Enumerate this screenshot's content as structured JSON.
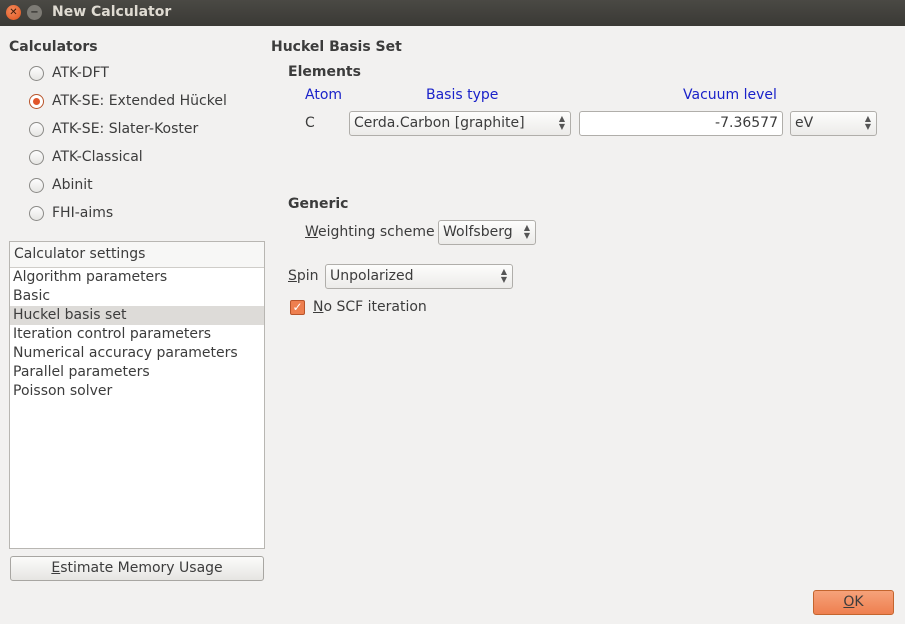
{
  "window": {
    "title": "New Calculator"
  },
  "calculators": {
    "heading": "Calculators",
    "options": [
      {
        "label": "ATK-DFT",
        "selected": false
      },
      {
        "label": "ATK-SE: Extended Hückel",
        "selected": true
      },
      {
        "label": "ATK-SE: Slater-Koster",
        "selected": false
      },
      {
        "label": "ATK-Classical",
        "selected": false
      },
      {
        "label": "Abinit",
        "selected": false
      },
      {
        "label": "FHI-aims",
        "selected": false
      }
    ]
  },
  "settings_list": {
    "header": "Calculator settings",
    "items": [
      "Algorithm parameters",
      "Basic",
      "Huckel basis set",
      "Iteration control parameters",
      "Numerical accuracy parameters",
      "Parallel parameters",
      "Poisson solver"
    ],
    "selected": "Huckel basis set"
  },
  "estimate_button": {
    "mnemonic": "E",
    "rest": "stimate Memory Usage"
  },
  "panel": {
    "title": "Huckel Basis Set",
    "elements_heading": "Elements",
    "columns": {
      "atom": "Atom",
      "basis_type": "Basis type",
      "vacuum_level": "Vacuum level"
    },
    "row": {
      "atom": "C",
      "basis_type": "Cerda.Carbon [graphite]",
      "vacuum_level": "-7.36577",
      "unit": "eV"
    },
    "generic_heading": "Generic",
    "weighting": {
      "mnemonic": "W",
      "rest": "eighting scheme",
      "value": "Wolfsberg"
    },
    "spin": {
      "mnemonic": "S",
      "rest": "pin",
      "value": "Unpolarized"
    },
    "no_scf": {
      "mnemonic": "N",
      "rest": "o SCF iteration",
      "checked": true
    }
  },
  "ok_button": {
    "mnemonic": "O",
    "rest": "K"
  },
  "colors": {
    "accent": "#ee7f4f",
    "column_header": "#1a22c9",
    "titlebar": "#3c3b37"
  }
}
